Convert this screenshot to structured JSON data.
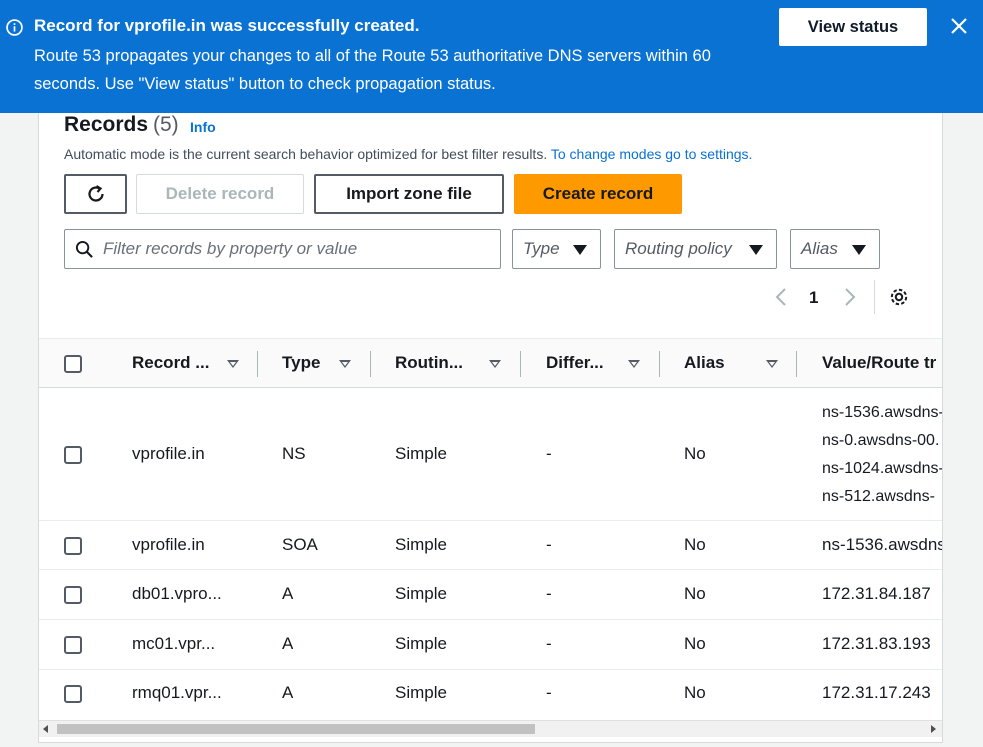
{
  "flash": {
    "title": "Record for vprofile.in was successfully created.",
    "message": "Route 53 propagates your changes to all of the Route 53 authoritative DNS servers within 60 seconds. Use \"View status\" button to check propagation status.",
    "view_status_label": "View status",
    "icon": "info-icon",
    "color": "#0972d3"
  },
  "records": {
    "title": "Records",
    "count": "(5)",
    "info_label": "Info",
    "description": "Automatic mode is the current search behavior optimized for best filter results.",
    "settings_link": "To change modes go to settings.",
    "buttons": {
      "delete": "Delete record",
      "import": "Import zone file",
      "create": "Create record"
    },
    "search_placeholder": "Filter records by property or value",
    "filters": {
      "type": "Type",
      "routing": "Routing policy",
      "alias": "Alias"
    },
    "pagination": {
      "page": "1"
    },
    "columns": [
      "Record ...",
      "Type",
      "Routin...",
      "Differ...",
      "Alias",
      "Value/Route tr"
    ],
    "rows": [
      {
        "name": "vprofile.in",
        "type": "NS",
        "routing": "Simple",
        "differ": "-",
        "alias": "No",
        "values": [
          "ns-1536.awsdns-",
          "ns-0.awsdns-00.",
          "ns-1024.awsdns-",
          "ns-512.awsdns-"
        ]
      },
      {
        "name": "vprofile.in",
        "type": "SOA",
        "routing": "Simple",
        "differ": "-",
        "alias": "No",
        "values": [
          "ns-1536.awsdns-"
        ]
      },
      {
        "name": "db01.vpro...",
        "type": "A",
        "routing": "Simple",
        "differ": "-",
        "alias": "No",
        "values": [
          "172.31.84.187"
        ]
      },
      {
        "name": "mc01.vpr...",
        "type": "A",
        "routing": "Simple",
        "differ": "-",
        "alias": "No",
        "values": [
          "172.31.83.193"
        ]
      },
      {
        "name": "rmq01.vpr...",
        "type": "A",
        "routing": "Simple",
        "differ": "-",
        "alias": "No",
        "values": [
          "172.31.17.243"
        ]
      }
    ],
    "accent_color": "#ff9900",
    "link_color": "#0972d3"
  }
}
